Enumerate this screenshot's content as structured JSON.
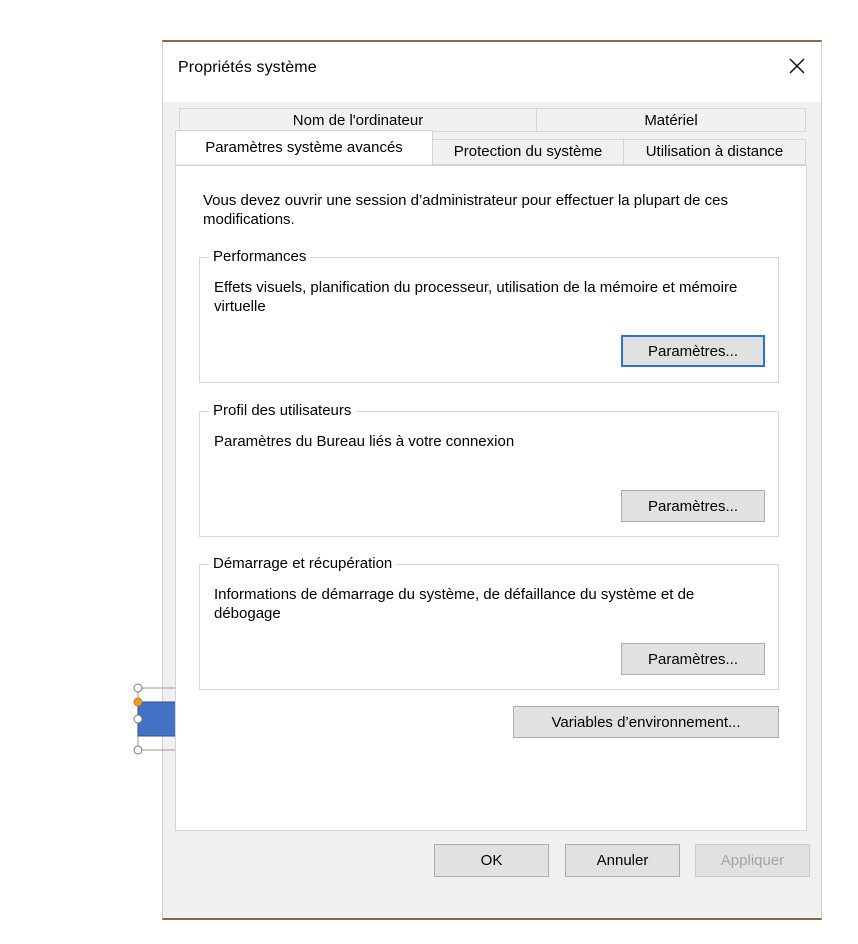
{
  "dialog": {
    "title": "Propriétés système",
    "close_icon": "close-icon"
  },
  "tabs": {
    "row1": [
      {
        "label": "Nom de l'ordinateur"
      },
      {
        "label": "Matériel"
      }
    ],
    "row2": [
      {
        "label": "Paramètres système avancés",
        "active": true
      },
      {
        "label": "Protection du système"
      },
      {
        "label": "Utilisation à distance"
      }
    ]
  },
  "panel": {
    "admin_note": "Vous devez ouvrir une session d’administrateur pour effectuer la plupart de ces modifications.",
    "performance": {
      "legend": "Performances",
      "description": "Effets visuels, planification du processeur, utilisation de la mémoire et mémoire virtuelle",
      "button": "Paramètres..."
    },
    "user_profiles": {
      "legend": "Profil des utilisateurs",
      "description": "Paramètres du Bureau liés à votre connexion",
      "button": "Paramètres..."
    },
    "startup_recovery": {
      "legend": "Démarrage et récupération",
      "description": "Informations de démarrage du système, de défaillance du système et de débogage",
      "button": "Paramètres..."
    },
    "env_vars_button": "Variables d’environnement..."
  },
  "footer": {
    "ok": "OK",
    "cancel": "Annuler",
    "apply": "Appliquer"
  },
  "overlay": {
    "shape": "right-arrow",
    "fill_color": "#4472c4",
    "handle_color": "#ffffff",
    "adjust_handle_color": "#ed9a2f",
    "rotate_icon": "rotate-handle-icon"
  }
}
